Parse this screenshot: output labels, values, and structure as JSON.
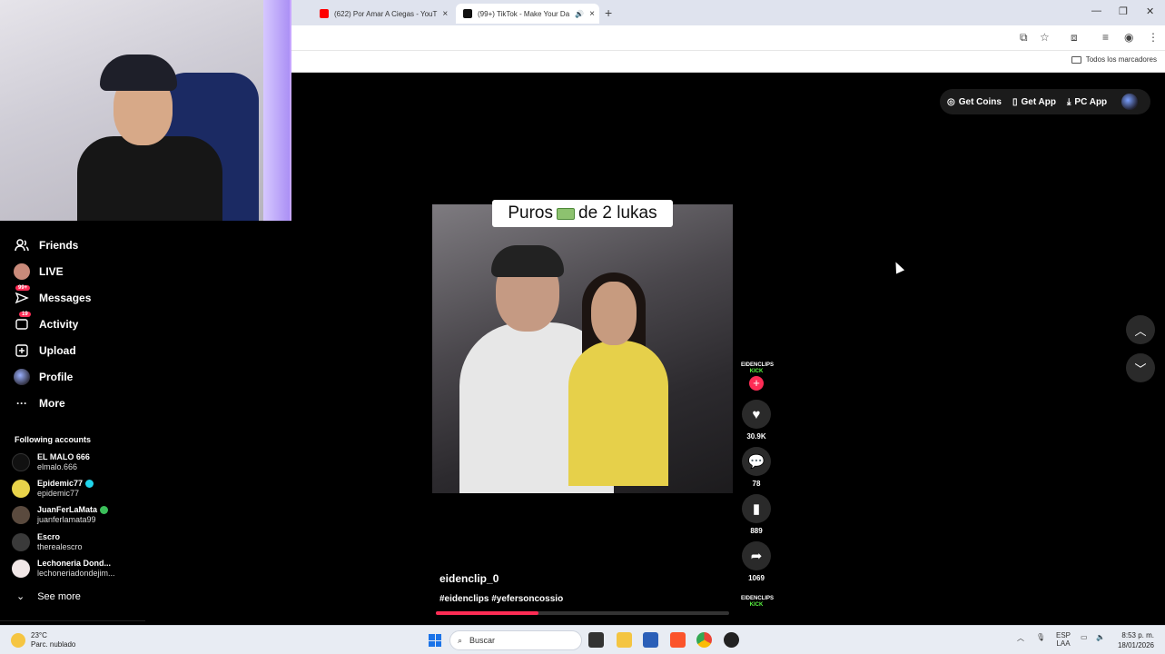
{
  "browser": {
    "tabs": [
      {
        "title": "(622) Por Amar A Ciegas - YouT"
      },
      {
        "title": "(99+) TikTok - Make Your Da"
      }
    ],
    "new_tab": "+",
    "bookmarks_folder": "Todos los marcadores"
  },
  "tiktok_header": {
    "get_coins": "Get Coins",
    "get_app": "Get App",
    "pc_app": "PC App"
  },
  "sidebar": {
    "nav": [
      {
        "label": "Friends",
        "icon": "friends-icon"
      },
      {
        "label": "LIVE",
        "icon": "live-icon"
      },
      {
        "label": "Messages",
        "icon": "messages-icon",
        "badge": "99+"
      },
      {
        "label": "Activity",
        "icon": "activity-icon",
        "badge": "19"
      },
      {
        "label": "Upload",
        "icon": "upload-icon"
      },
      {
        "label": "Profile",
        "icon": "profile-icon"
      },
      {
        "label": "More",
        "icon": "more-icon"
      }
    ],
    "following_title": "Following accounts",
    "accounts": [
      {
        "name": "EL MALO 666",
        "handle": "elmalo.666"
      },
      {
        "name": "Epidemic77",
        "handle": "epidemic77",
        "verified": true
      },
      {
        "name": "JuanFerLaMata",
        "handle": "juanferlamata99",
        "verified": true
      },
      {
        "name": "Escro",
        "handle": "therealescro"
      },
      {
        "name": "Lechoneria Dond...",
        "handle": "lechoneriadondejim..."
      }
    ],
    "see_more": "See more"
  },
  "video": {
    "caption_before": "Puros",
    "caption_after": "de 2 lukas",
    "author": "eidenclip_0",
    "hashtags": "#eidenclips #yefersoncossio",
    "progress": 0.35
  },
  "actions": {
    "creator_logo_line1": "EIDENCLIPS",
    "creator_logo_line2": "KICK",
    "likes": "30.9K",
    "comments": "78",
    "saves": "889",
    "shares": "1069"
  },
  "taskbar": {
    "temperature": "23°C",
    "weather": "Parc. nublado",
    "search_placeholder": "Buscar",
    "lang1": "ESP",
    "lang2": "LAA",
    "time": "8:53 p. m.",
    "date": "18/01/2026"
  },
  "colors": {
    "accent": "#fe2c55",
    "background": "#000000",
    "taskbar": "#e8ecf3"
  }
}
